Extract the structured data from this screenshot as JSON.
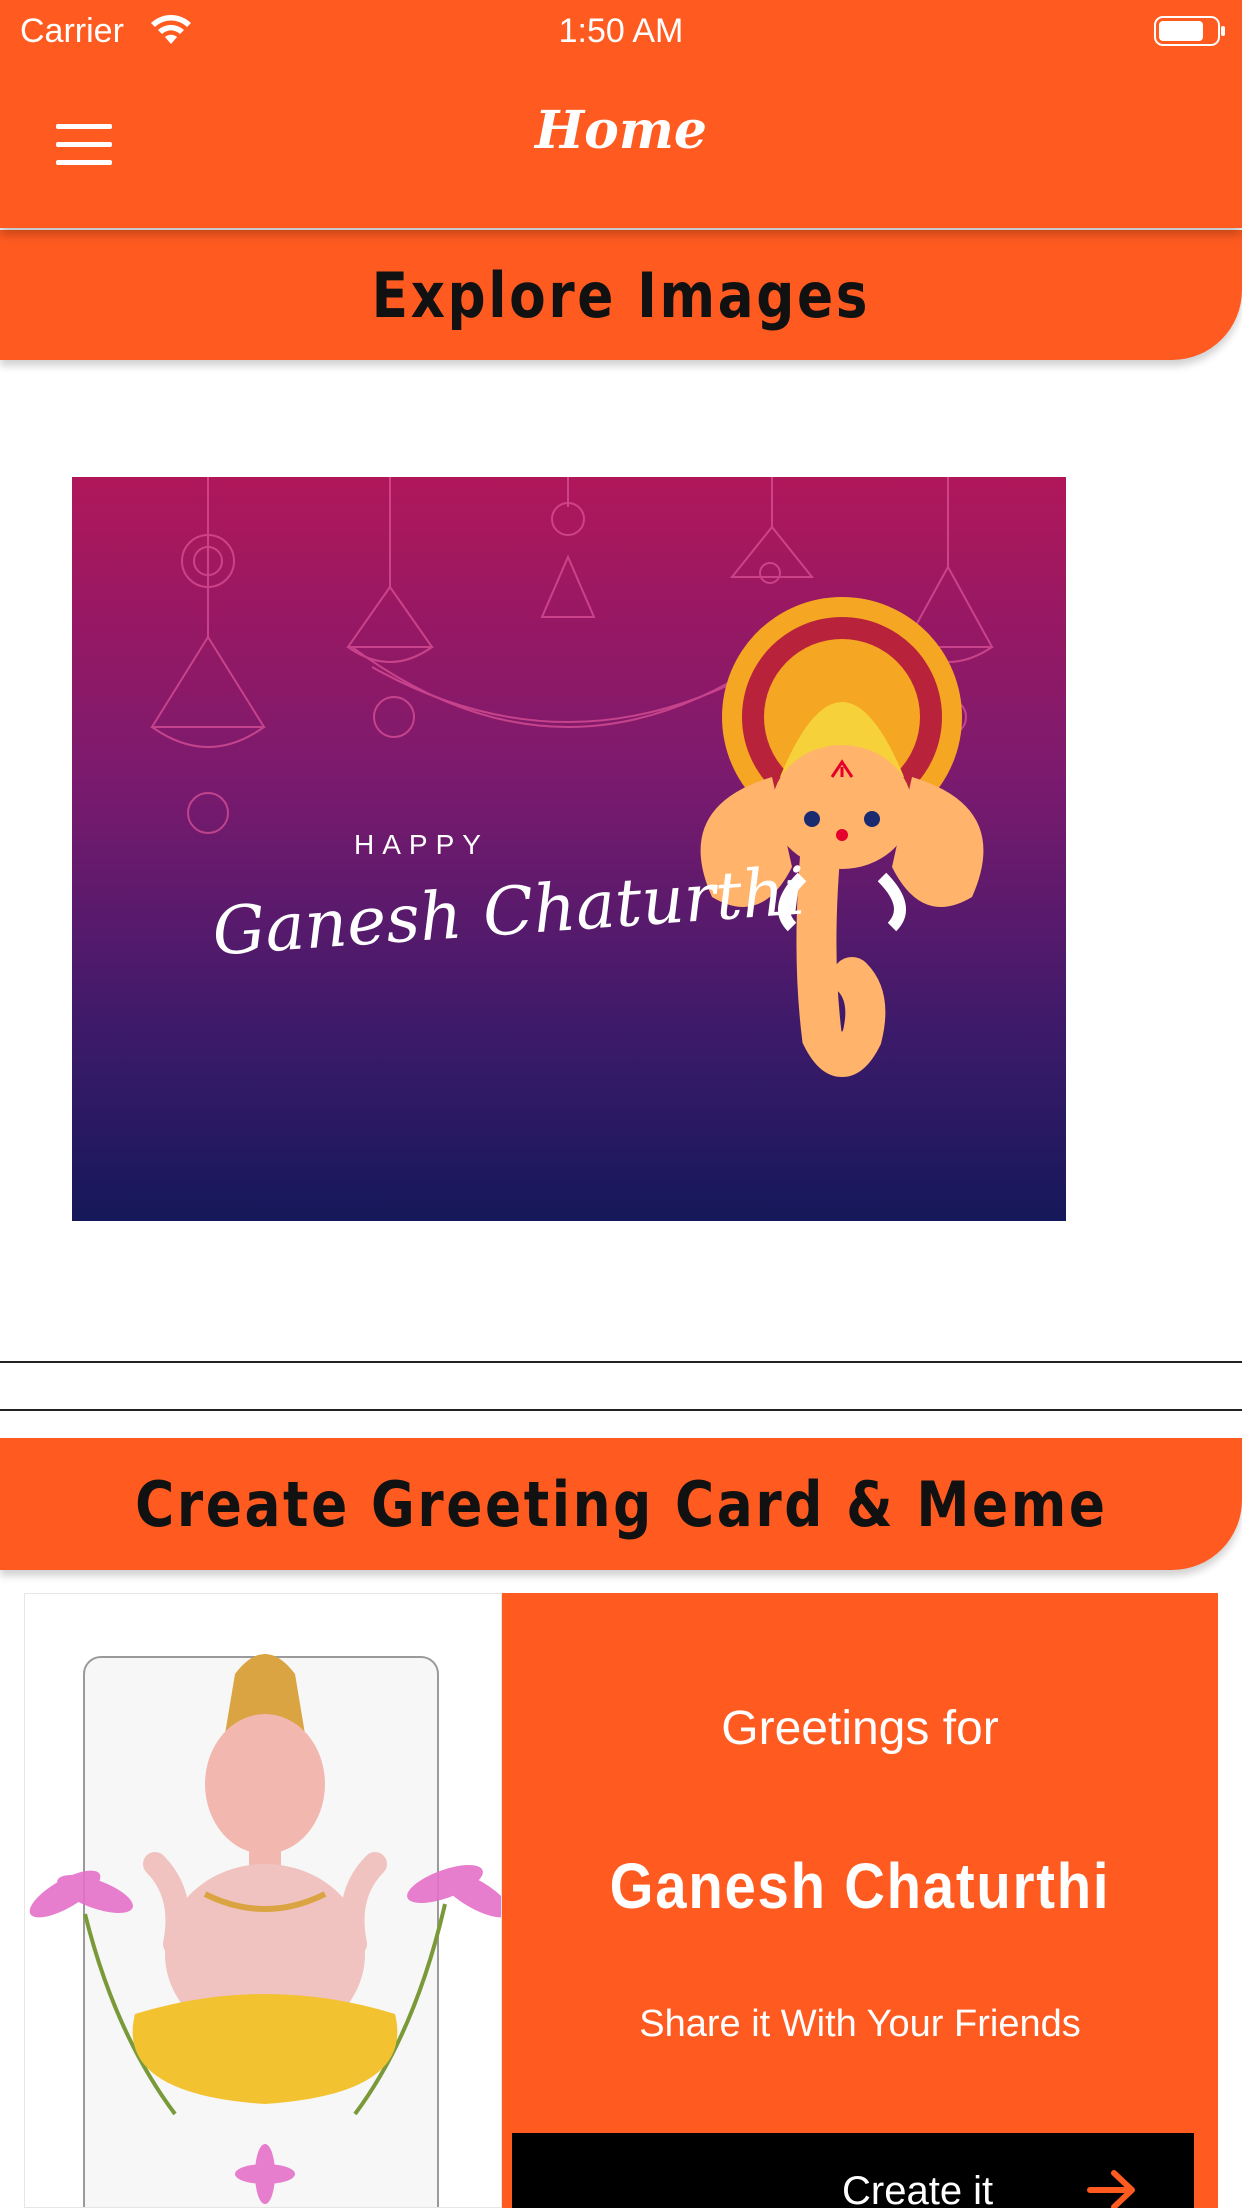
{
  "status_bar": {
    "carrier": "Carrier",
    "time": "1:50 AM"
  },
  "nav": {
    "title": "Home",
    "menu_icon": "hamburger-menu-icon"
  },
  "explore": {
    "header": "Explore Images",
    "banner": {
      "line1": "HAPPY",
      "line2": "Ganesh Chaturthi"
    }
  },
  "greeting": {
    "header": "Create Greeting Card & Meme",
    "line1": "Greetings for",
    "line2": "Ganesh Chaturthi",
    "line3": "Share it With Your Friends",
    "button_label": "Create it",
    "button_icon": "arrow-right-icon"
  },
  "colors": {
    "accent": "#ff5b21",
    "button": "#000000"
  }
}
